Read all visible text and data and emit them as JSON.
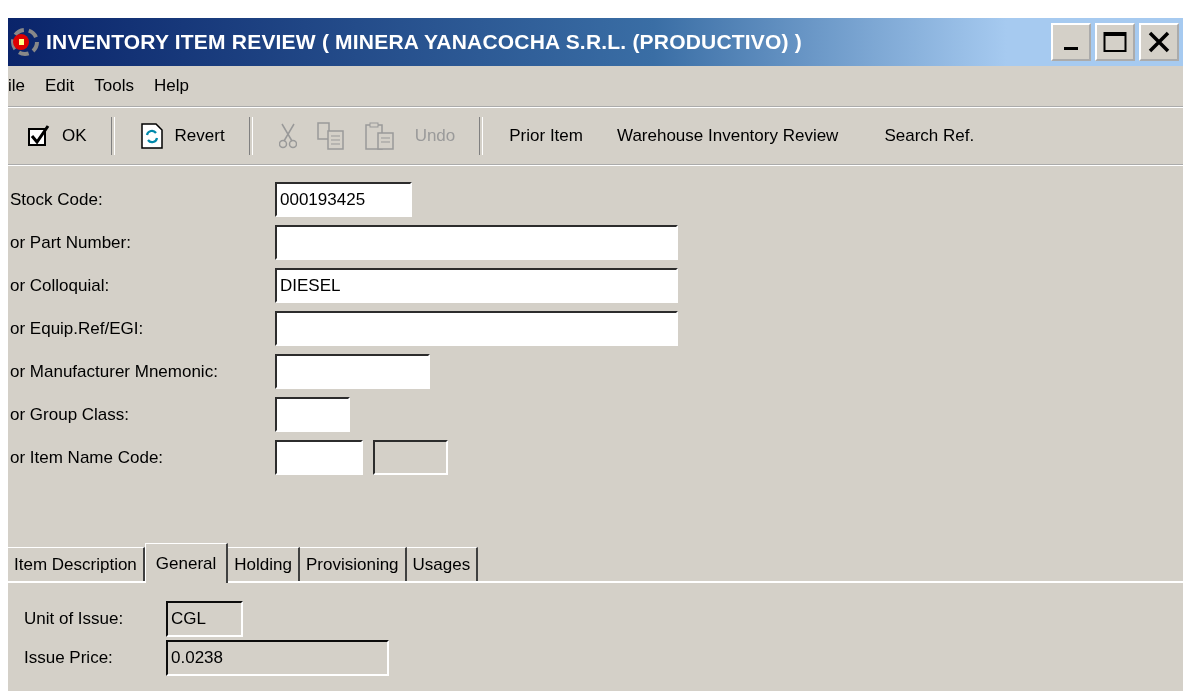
{
  "window": {
    "title": "INVENTORY ITEM REVIEW ( MINERA YANACOCHA S.R.L. (PRODUCTIVO) )"
  },
  "menu": [
    "ile",
    "Edit",
    "Tools",
    "Help"
  ],
  "toolbar": [
    {
      "kind": "icon-text",
      "label": "OK",
      "disabled": false
    },
    {
      "kind": "separator"
    },
    {
      "kind": "icon-text",
      "label": "Revert",
      "disabled": false
    },
    {
      "kind": "separator"
    },
    {
      "kind": "icon",
      "disabled": true
    },
    {
      "kind": "icon",
      "disabled": true
    },
    {
      "kind": "icon",
      "disabled": true
    },
    {
      "kind": "text",
      "label": "Undo",
      "disabled": true
    },
    {
      "kind": "separator"
    },
    {
      "kind": "text",
      "label": "Prior Item",
      "disabled": false
    },
    {
      "kind": "text",
      "label": "Warehouse Inventory Review",
      "disabled": false
    },
    {
      "kind": "text",
      "label": "Search Ref.",
      "disabled": false
    }
  ],
  "form": [
    {
      "label": "Stock Code:",
      "fields": [
        {
          "value": "000193425",
          "disabled": false
        }
      ]
    },
    {
      "label": "or Part Number:",
      "fields": [
        {
          "disabled": false
        }
      ]
    },
    {
      "label": "or Colloquial:",
      "fields": [
        {
          "value": "DIESEL",
          "disabled": false
        }
      ]
    },
    {
      "label": "or Equip.Ref/EGI:",
      "fields": [
        {
          "disabled": false
        }
      ]
    },
    {
      "label": "or Manufacturer Mnemonic:",
      "fields": [
        {
          "disabled": false
        }
      ]
    },
    {
      "label": "or Group Class:",
      "fields": [
        {
          "disabled": false
        }
      ]
    },
    {
      "label": "or Item Name Code:",
      "fields": [
        {
          "disabled": false
        },
        {
          "disabled": true
        }
      ]
    }
  ],
  "tabs": [
    {
      "label": "Item Description",
      "selected": false
    },
    {
      "label": "General",
      "selected": true
    },
    {
      "label": "Holding",
      "selected": false
    },
    {
      "label": "Provisioning",
      "selected": false
    },
    {
      "label": "Usages",
      "selected": false
    }
  ],
  "general": [
    {
      "label": "Unit of Issue:",
      "value": "CGL"
    },
    {
      "label": "Issue Price:",
      "value": "0.0238"
    }
  ]
}
